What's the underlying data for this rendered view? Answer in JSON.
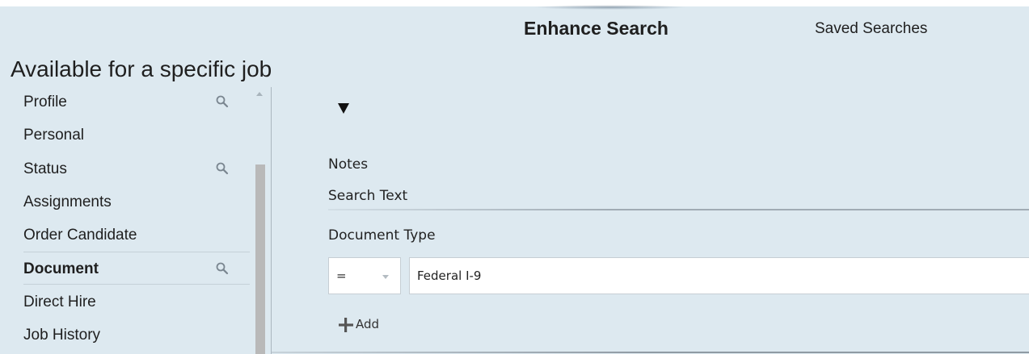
{
  "header": {
    "tabs": [
      {
        "label": "Enhance Search",
        "active": true
      },
      {
        "label": "Saved Searches",
        "active": false
      }
    ]
  },
  "page_title": "Available for a specific job",
  "sidebar": {
    "items": [
      {
        "label": "Profile",
        "has_search_icon": true,
        "selected": false
      },
      {
        "label": "Personal",
        "has_search_icon": false,
        "selected": false
      },
      {
        "label": "Status",
        "has_search_icon": true,
        "selected": false
      },
      {
        "label": "Assignments",
        "has_search_icon": false,
        "selected": false
      },
      {
        "label": "Order Candidate",
        "has_search_icon": false,
        "selected": false
      },
      {
        "label": "Document",
        "has_search_icon": true,
        "selected": true
      },
      {
        "label": "Direct Hire",
        "has_search_icon": false,
        "selected": false
      },
      {
        "label": "Job History",
        "has_search_icon": false,
        "selected": false
      }
    ]
  },
  "main": {
    "filter_icon": "filter-funnel-icon",
    "fields": {
      "notes_label": "Notes",
      "search_text_label": "Search Text",
      "document_type_label": "Document Type"
    },
    "criteria": {
      "operator": "=",
      "value": "Federal I-9"
    },
    "add_label": "Add"
  },
  "colors": {
    "background": "#dde9f0",
    "scroll_thumb": "#b9b9b9",
    "text": "#1f1f1f"
  }
}
